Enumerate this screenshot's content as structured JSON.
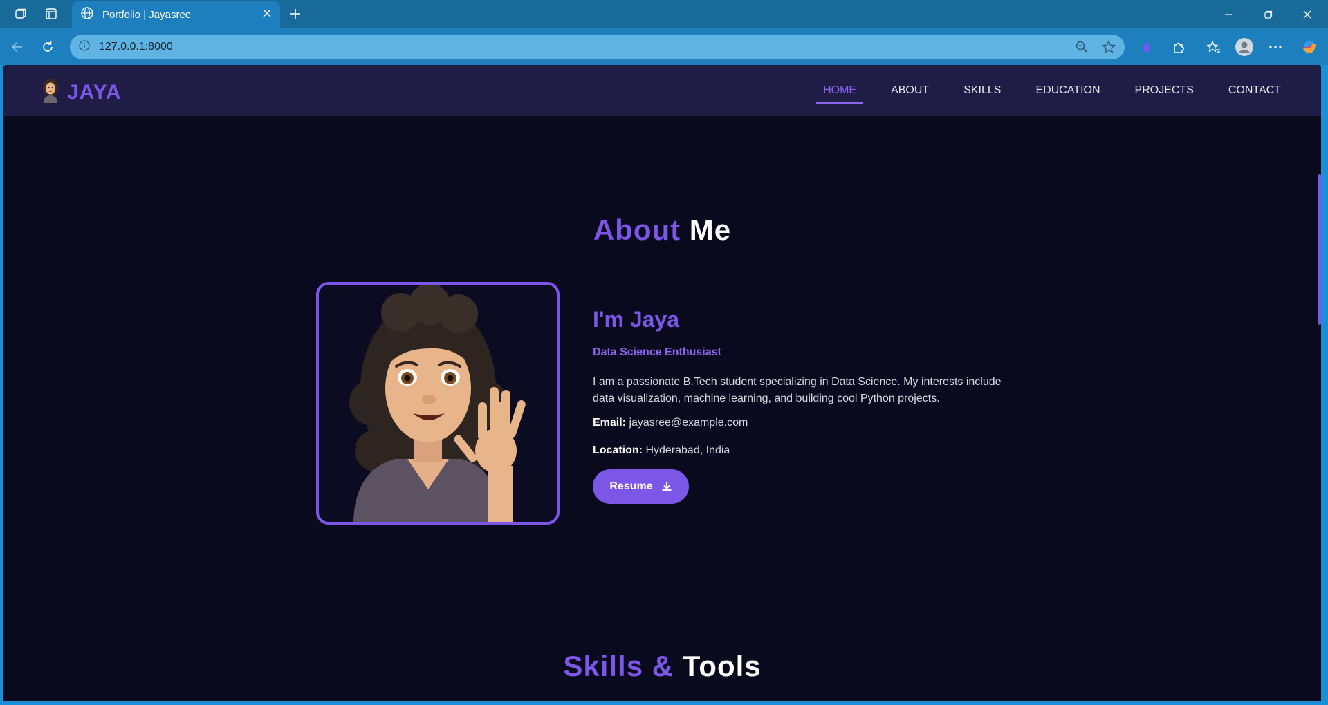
{
  "browser": {
    "tab_title": "Portfolio | Jayasree",
    "url": "127.0.0.1:8000"
  },
  "navbar": {
    "brand": "JAYA",
    "links": [
      "HOME",
      "ABOUT",
      "SKILLS",
      "EDUCATION",
      "PROJECTS",
      "CONTACT"
    ],
    "active": "HOME"
  },
  "about": {
    "heading_accent": "About",
    "heading_rest": "Me",
    "name": "I'm Jaya",
    "role": "Data Science Enthusiast",
    "description": "I am a passionate B.Tech student specializing in Data Science. My interests include data visualization, machine learning, and building cool Python projects.",
    "email_label": "Email:",
    "email": "jayasree@example.com",
    "location_label": "Location:",
    "location": "Hyderabad, India",
    "resume_label": "Resume"
  },
  "skills": {
    "heading_accent": "Skills &",
    "heading_rest": "Tools"
  },
  "colors": {
    "accent": "#7c56e6",
    "page_bg": "#0a0a1f",
    "navbar_bg": "#1f1d45"
  }
}
